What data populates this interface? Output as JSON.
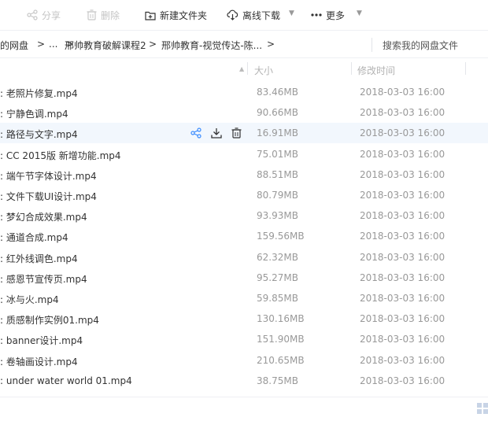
{
  "toolbar": {
    "share_label": "分享",
    "delete_label": "删除",
    "new_folder_label": "新建文件夹",
    "offline_download_label": "离线下载",
    "more_label": "更多"
  },
  "breadcrumb": {
    "root": "我的网盘",
    "ellipsis": "...",
    "level1": "邢帅教育破解课程2",
    "level2": "邢帅教育-视觉传达-陈...",
    "sep": ">"
  },
  "search": {
    "placeholder": "搜索我的网盘文件"
  },
  "columns": {
    "size": "大小",
    "modified": "修改时间"
  },
  "files": [
    {
      "name": ": 老照片修复.mp4",
      "size": "83.46MB",
      "time": "2018-03-03 16:00"
    },
    {
      "name": ": 宁静色调.mp4",
      "size": "90.66MB",
      "time": "2018-03-03 16:00"
    },
    {
      "name": ": 路径与文字.mp4",
      "size": "16.91MB",
      "time": "2018-03-03 16:00"
    },
    {
      "name": ": CC 2015版 新增功能.mp4",
      "size": "75.01MB",
      "time": "2018-03-03 16:00"
    },
    {
      "name": ": 端午节字体设计.mp4",
      "size": "88.51MB",
      "time": "2018-03-03 16:00"
    },
    {
      "name": ": 文件下载UI设计.mp4",
      "size": "80.79MB",
      "time": "2018-03-03 16:00"
    },
    {
      "name": ": 梦幻合成效果.mp4",
      "size": "93.93MB",
      "time": "2018-03-03 16:00"
    },
    {
      "name": ": 通道合成.mp4",
      "size": "159.56MB",
      "time": "2018-03-03 16:00"
    },
    {
      "name": ": 红外线调色.mp4",
      "size": "62.32MB",
      "time": "2018-03-03 16:00"
    },
    {
      "name": ": 感恩节宣传页.mp4",
      "size": "95.27MB",
      "time": "2018-03-03 16:00"
    },
    {
      "name": ": 冰与火.mp4",
      "size": "59.85MB",
      "time": "2018-03-03 16:00"
    },
    {
      "name": ": 质感制作实例01.mp4",
      "size": "130.16MB",
      "time": "2018-03-03 16:00"
    },
    {
      "name": ": banner设计.mp4",
      "size": "151.90MB",
      "time": "2018-03-03 16:00"
    },
    {
      "name": ": 卷轴画设计.mp4",
      "size": "210.65MB",
      "time": "2018-03-03 16:00"
    },
    {
      "name": ": under water world 01.mp4",
      "size": "38.75MB",
      "time": "2018-03-03 16:00"
    }
  ],
  "hovered_row": 2,
  "colors": {
    "accent": "#3b8cff",
    "hover_bg": "#f2f7fd",
    "muted": "#999999"
  }
}
